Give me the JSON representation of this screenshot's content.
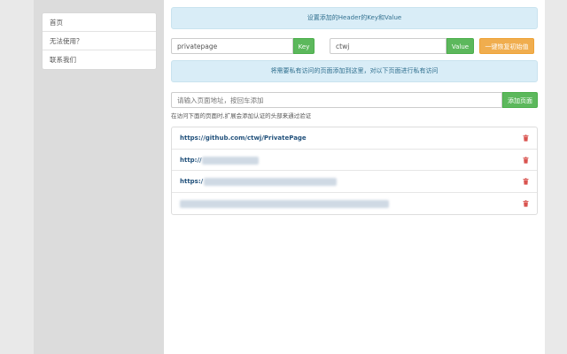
{
  "sidebar": {
    "items": [
      {
        "label": "首页"
      },
      {
        "label": "无法使用？"
      },
      {
        "label": "联系我们"
      }
    ]
  },
  "header_alert": {
    "text": "设置添加的Header的Key和Value"
  },
  "key_field": {
    "value": "privatepage",
    "button_label": "Key"
  },
  "value_field": {
    "value": "ctwj",
    "button_label": "Value"
  },
  "reset_button": {
    "label": "一键恢复初始值"
  },
  "info_alert": {
    "text": "将需要私有访问的页面添加到这里，对以下页面进行私有访问"
  },
  "add_page": {
    "placeholder": "请输入页面地址，按回车添加",
    "button_label": "添加页面"
  },
  "hint": {
    "text": "在访问下面的页面时,扩展会添加认证的头部来通过验证"
  },
  "pages": [
    {
      "url": "https://github.com/ctwj/PrivatePage",
      "blurred": false
    },
    {
      "url": "http://",
      "blurred": true
    },
    {
      "url": "https:/",
      "blurred": true
    },
    {
      "url": "",
      "blurred": true
    }
  ],
  "colors": {
    "alert_bg": "#d9edf7",
    "alert_text": "#31708f",
    "green": "#5cb85c",
    "orange": "#f0ad4e",
    "link": "#23527c",
    "danger": "#d9534f"
  },
  "icons": {
    "delete": "trash-icon"
  }
}
